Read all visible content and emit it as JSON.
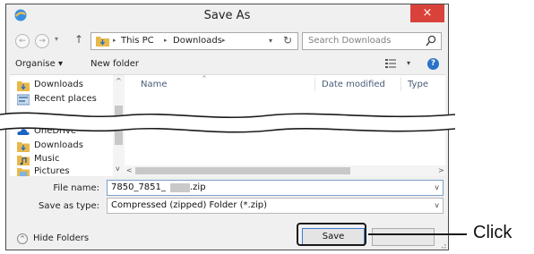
{
  "window": {
    "title": "Save As",
    "close_glyph": "×"
  },
  "address_bar": {
    "back_glyph": "←",
    "forward_glyph": "→",
    "up_glyph": "↑",
    "crumbs": [
      "This PC",
      "Downloads"
    ],
    "search_placeholder": "Search Downloads"
  },
  "toolbar": {
    "organise_label": "Organise ▾",
    "new_folder_label": "New folder",
    "help_glyph": "?"
  },
  "nav_pane": {
    "items_top": [
      {
        "label": "Downloads",
        "icon": "downloads-icon"
      },
      {
        "label": "Recent places",
        "icon": "recent-places-icon"
      }
    ],
    "items_bottom": [
      {
        "label": "OneDrive",
        "icon": "onedrive-icon"
      },
      {
        "label": "Downloads",
        "icon": "downloads-icon"
      },
      {
        "label": "Music",
        "icon": "music-icon"
      },
      {
        "label": "Pictures",
        "icon": "pictures-icon"
      }
    ]
  },
  "file_list": {
    "columns": [
      "Name",
      "Date modified",
      "Type"
    ]
  },
  "form": {
    "file_name_label": "File name:",
    "file_name_prefix": "7850_7851_",
    "file_name_suffix": ".zip",
    "save_type_label": "Save as type:",
    "save_type_value": "Compressed (zipped) Folder (*.zip)"
  },
  "footer": {
    "hide_folders_label": "Hide Folders",
    "save_label": "Save"
  },
  "annotation": {
    "text": "Click"
  },
  "colors": {
    "accent": "#3b7bd1",
    "close": "#d9423a",
    "folder": "#e8b94a"
  }
}
